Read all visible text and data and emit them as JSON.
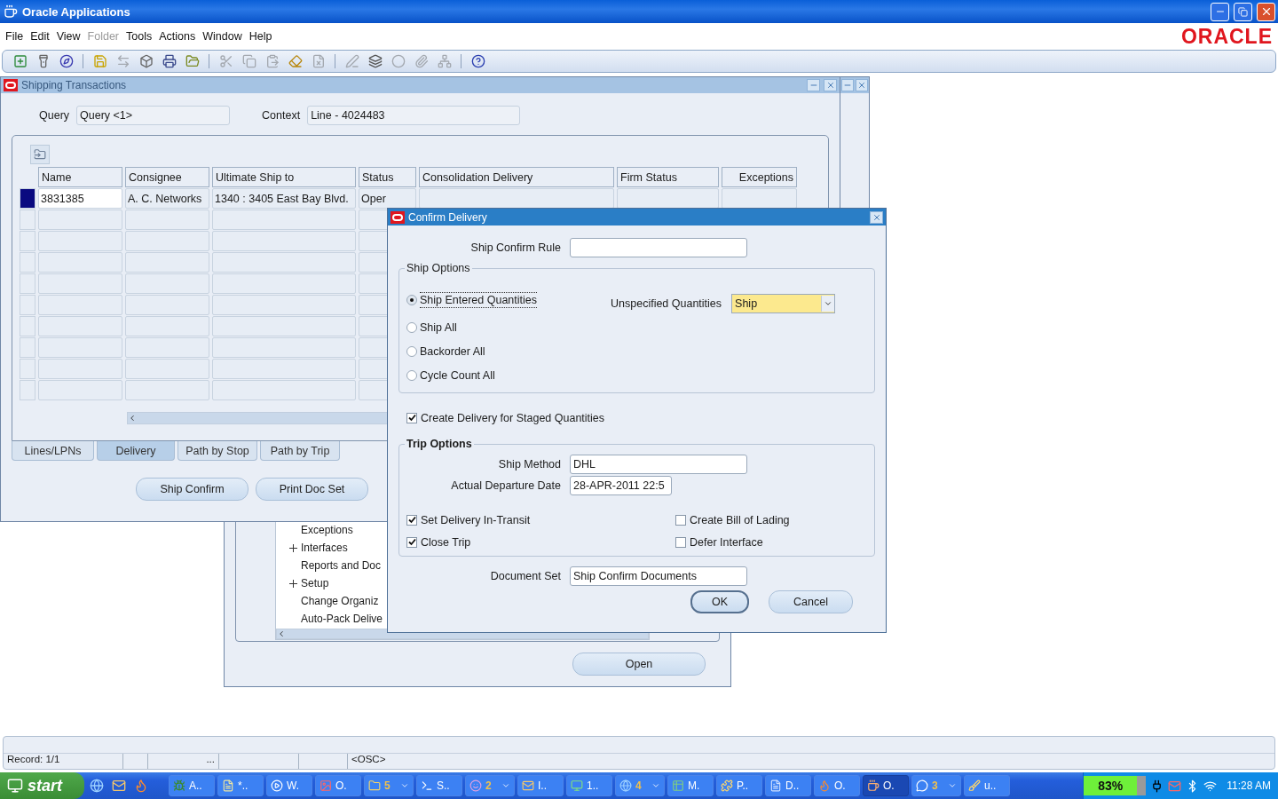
{
  "window": {
    "title": "Oracle Applications"
  },
  "menu": [
    {
      "label": "File",
      "disabled": false
    },
    {
      "label": "Edit",
      "disabled": false
    },
    {
      "label": "View",
      "disabled": false
    },
    {
      "label": "Folder",
      "disabled": true
    },
    {
      "label": "Tools",
      "disabled": false
    },
    {
      "label": "Actions",
      "disabled": false
    },
    {
      "label": "Window",
      "disabled": false
    },
    {
      "label": "Help",
      "disabled": false
    }
  ],
  "logo": "ORACLE",
  "toolbar": [
    {
      "disabled": false
    },
    {
      "disabled": false
    },
    {
      "disabled": false
    },
    {
      "disabled": false
    },
    {
      "disabled": true
    },
    {
      "disabled": false
    },
    {
      "disabled": false
    },
    {
      "disabled": false
    },
    {
      "disabled": true
    },
    {
      "disabled": true
    },
    {
      "disabled": true
    },
    {
      "disabled": false
    },
    {
      "disabled": true
    },
    {
      "disabled": true
    },
    {
      "disabled": false
    },
    {
      "disabled": true
    },
    {
      "disabled": true
    },
    {
      "disabled": true
    },
    {
      "disabled": false
    }
  ],
  "navigator": {
    "tree": [
      {
        "label": "Exceptions",
        "expandable": false
      },
      {
        "label": "Interfaces",
        "expandable": true
      },
      {
        "label": "Reports and Doc",
        "expandable": false
      },
      {
        "label": "Setup",
        "expandable": true
      },
      {
        "label": "Change Organiz",
        "expandable": false
      },
      {
        "label": "Auto-Pack Delive",
        "expandable": false
      }
    ],
    "open_button": "Open"
  },
  "shipping": {
    "title": "Shipping Transactions",
    "query_label": "Query",
    "query_value": "Query <1>",
    "context_label": "Context",
    "context_value": "Line - 4024483",
    "columns": [
      "Name",
      "Consignee",
      "Ultimate Ship to",
      "Status",
      "Consolidation Delivery",
      "Firm Status",
      "Exceptions"
    ],
    "rows": [
      {
        "selected": true,
        "cells": [
          "3831385",
          "A. C. Networks",
          "1340 : 3405 East Bay Blvd.",
          "Oper"
        ]
      }
    ],
    "tabs": [
      {
        "label": "Lines/LPNs",
        "selected": false
      },
      {
        "label": "Delivery",
        "selected": true
      },
      {
        "label": "Path by Stop",
        "selected": false
      },
      {
        "label": "Path by Trip",
        "selected": false
      }
    ],
    "buttons": [
      "Ship Confirm",
      "Print Doc Set"
    ]
  },
  "dialog": {
    "title": "Confirm Delivery",
    "ship_confirm_rule_label": "Ship Confirm Rule",
    "ship_options_title": "Ship Options",
    "options": [
      {
        "label": "Ship Entered Quantities",
        "selected": true
      },
      {
        "label": "Ship All",
        "selected": false
      },
      {
        "label": "Backorder All",
        "selected": false
      },
      {
        "label": "Cycle Count All",
        "selected": false
      }
    ],
    "unspecified_label": "Unspecified Quantities",
    "unspecified_value": "Ship",
    "staged": {
      "label": "Create Delivery for Staged Quantities",
      "checked": true
    },
    "trip_options_title": "Trip Options",
    "ship_method_label": "Ship Method",
    "ship_method": "DHL",
    "departure_label": "Actual Departure Date",
    "departure": "28-APR-2011 22:5",
    "trip_checks": [
      {
        "label": "Set Delivery In-Transit",
        "checked": true
      },
      {
        "label": "Create Bill of Lading",
        "checked": false
      },
      {
        "label": "Close Trip",
        "checked": true
      },
      {
        "label": "Defer Interface",
        "checked": false
      }
    ],
    "document_set_label": "Document Set",
    "document_set": "Ship Confirm Documents",
    "buttons": [
      "OK",
      "Cancel"
    ]
  },
  "status_bar": {
    "record": "Record: 1/1",
    "more": "...",
    "mode": "<OSC>"
  },
  "taskbar": {
    "start": "start",
    "tasks": [
      {
        "label": "A..",
        "kind": "single",
        "selected": false
      },
      {
        "label": "*..",
        "kind": "single",
        "selected": false
      },
      {
        "label": "W.",
        "kind": "single",
        "selected": false
      },
      {
        "label": "O.",
        "kind": "single",
        "selected": false
      },
      {
        "label": "5",
        "kind": "group",
        "selected": false
      },
      {
        "label": "S..",
        "kind": "single",
        "selected": false
      },
      {
        "label": "2",
        "kind": "group",
        "selected": false
      },
      {
        "label": "I..",
        "kind": "single",
        "selected": false
      },
      {
        "label": "1..",
        "kind": "single",
        "selected": false
      },
      {
        "label": "4",
        "kind": "group",
        "selected": false
      },
      {
        "label": "M.",
        "kind": "single",
        "selected": false
      },
      {
        "label": "P..",
        "kind": "single",
        "selected": false
      },
      {
        "label": "D..",
        "kind": "single",
        "selected": false
      },
      {
        "label": "O.",
        "kind": "single",
        "selected": false
      },
      {
        "label": "O.",
        "kind": "single",
        "selected": true
      },
      {
        "label": "3",
        "kind": "group",
        "selected": false
      },
      {
        "label": "u..",
        "kind": "single",
        "selected": false
      }
    ],
    "battery": "83%",
    "clock": "11:28 AM"
  }
}
